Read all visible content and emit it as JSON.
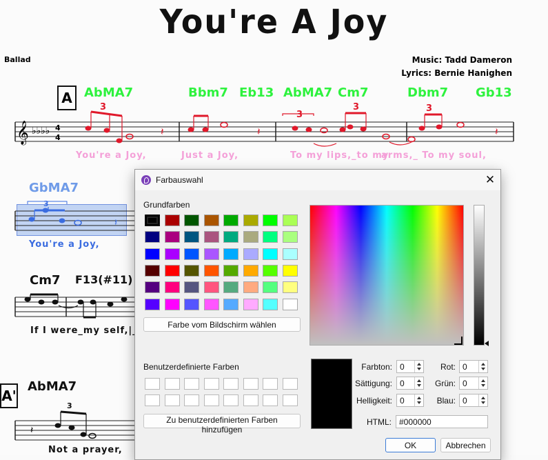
{
  "sheet": {
    "title": "You're A Joy",
    "style": "Ballad",
    "music": "Music: Tadd Dameron",
    "lyrics": "Lyrics: Bernie Hanighen",
    "rehearsal_a": "A",
    "rehearsal_a2": "A'",
    "chords_row1": [
      "AbMA7",
      "Bbm7",
      "Eb13",
      "AbMA7",
      "Cm7",
      "Dbm7",
      "Gb13"
    ],
    "lyrics_row1": [
      "You're a Joy,",
      "Just a Joy,",
      "To my lips,_to my",
      "arms,_ To my soul,"
    ],
    "chord_row2": "GbMA7",
    "lyric_row2": "You're a Joy,",
    "chords_row3": [
      "Cm7",
      "F13(#11)"
    ],
    "lyric_row3": "If I were_my self,|_",
    "chord_row4": "AbMA7",
    "lyric_row4": "Not a prayer,",
    "tuplet": "3",
    "chord_color": "#2ef23e",
    "lyric_color": "#f4a0d8",
    "triplet_color": "#e0182a",
    "selection_color": "#3a6ce0"
  },
  "dialog": {
    "title": "Farbauswahl",
    "close_icon": "close-icon",
    "basic_colors_label": "Grundfarben",
    "basic_colors": [
      [
        "#000000",
        "#aa0000",
        "#005500",
        "#aa5500",
        "#00aa00",
        "#aaaa00",
        "#00ff00",
        "#aaff55"
      ],
      [
        "#000080",
        "#aa007f",
        "#005580",
        "#aa557f",
        "#00aa7f",
        "#aaaa7f",
        "#00ff7f",
        "#aaff7f"
      ],
      [
        "#0000ff",
        "#aa00ff",
        "#0055ff",
        "#aa55ff",
        "#00aaff",
        "#aaaaff",
        "#00ffff",
        "#aaffff"
      ],
      [
        "#550000",
        "#ff0000",
        "#555500",
        "#ff5500",
        "#55aa00",
        "#ffaa00",
        "#55ff00",
        "#ffff00"
      ],
      [
        "#550080",
        "#ff007f",
        "#555580",
        "#ff557f",
        "#55aa7f",
        "#ffaa7f",
        "#55ff7f",
        "#ffff7f"
      ],
      [
        "#5500ff",
        "#ff00ff",
        "#5555ff",
        "#ff55ff",
        "#55aaff",
        "#ffaaff",
        "#55ffff",
        "#ffffff"
      ]
    ],
    "pick_screen_button": "Farbe vom Bildschirm wählen",
    "custom_colors_label": "Benutzerdefinierte Farben",
    "add_custom_button": "Zu benutzerdefinierten Farben hinzufügen",
    "preview_color": "#000000",
    "fields": {
      "hue_label": "Farbton:",
      "hue": "0",
      "sat_label": "Sättigung:",
      "sat": "0",
      "val_label": "Helligkeit:",
      "val": "0",
      "red_label": "Rot:",
      "red": "0",
      "green_label": "Grün:",
      "green": "0",
      "blue_label": "Blau:",
      "blue": "0",
      "html_label": "HTML:",
      "html": "#000000"
    },
    "ok_button": "OK",
    "cancel_button": "Abbrechen"
  }
}
